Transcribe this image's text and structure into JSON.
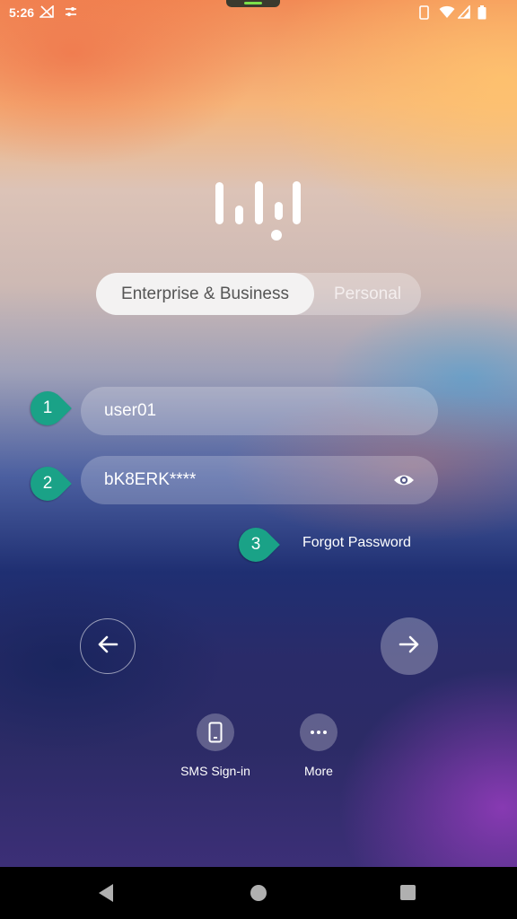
{
  "status_bar": {
    "time": "5:26",
    "left_icons": [
      "signal-off-icon",
      "settings-sliders-icon"
    ],
    "right_icons": [
      "vibrate-icon",
      "wifi-icon",
      "cell-signal-icon",
      "battery-icon"
    ]
  },
  "login": {
    "tabs": [
      {
        "label": "Enterprise & Business",
        "selected": true
      },
      {
        "label": "Personal",
        "selected": false
      }
    ],
    "username_value": "user01",
    "password_value": "bK8ERK****",
    "forgot_label": "Forgot Password"
  },
  "annotations": {
    "badge1": "1",
    "badge2": "2",
    "badge3": "3",
    "color": "#1aa287"
  },
  "options": {
    "sms_label": "SMS Sign-in",
    "more_label": "More"
  }
}
